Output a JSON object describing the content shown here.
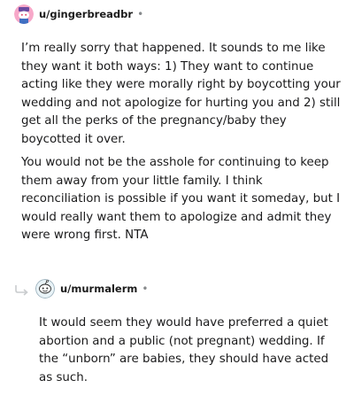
{
  "comments": [
    {
      "username": "u/gingerbreadbr",
      "separator": "•",
      "avatar_icon": "pink-snoo-avatar-icon",
      "paragraphs": [
        "I’m really sorry that happened. It sounds to me like they want it both ways: 1) They want to continue acting like they were morally right by boycotting your wedding and not apologize for hurting you and 2) still get all the perks of the pregnancy/baby they boycotted it over.",
        "You would not be the asshole for continuing to keep them away from your little family. I think reconciliation is possible if you want it someday, but I would really want them to apologize and admit they were wrong first. NTA"
      ]
    },
    {
      "username": "u/murmalerm",
      "separator": "•",
      "avatar_icon": "white-snoo-avatar-icon",
      "reply_icon": "reply-arrow-icon",
      "paragraphs": [
        "It would seem they would have preferred a quiet abortion and a public (not pregnant) wedding. If the “unborn” are babies, they should have acted as such."
      ]
    }
  ],
  "colors": {
    "text": "#1a1a1b",
    "meta": "#878a8c",
    "avatar1_bg": "#f7a8c9",
    "avatar2_bg": "#e9f3f7"
  }
}
